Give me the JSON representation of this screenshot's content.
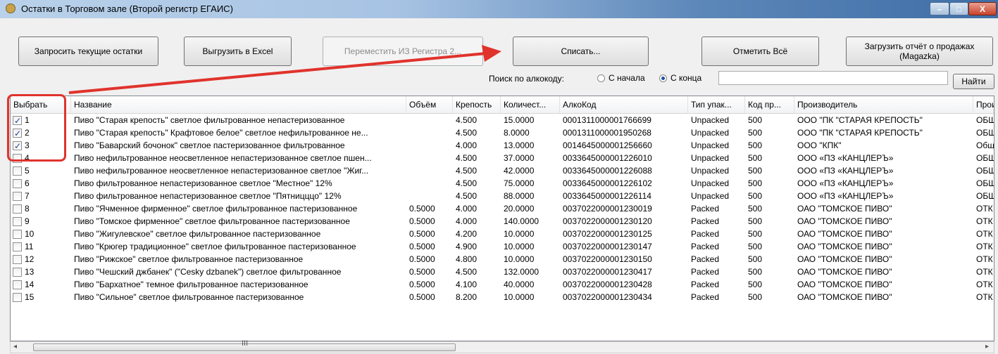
{
  "window": {
    "title": "Остатки в Торговом зале (Второй регистр ЕГАИС)",
    "close": "X",
    "min": "–",
    "max": "□"
  },
  "toolbar": {
    "request_stock": "Запросить текущие остатки",
    "export_excel": "Выгрузить в Excel",
    "move_from_register": "Переместить ИЗ Регистра 2...",
    "write_off": "Списать...",
    "select_all": "Отметить Всё",
    "load_sales": "Загрузить отчёт о продажах (Magazka)"
  },
  "search": {
    "label": "Поиск по алкокоду:",
    "from_start": "С начала",
    "from_end": "С конца",
    "selected": "С конца",
    "value": "",
    "find": "Найти"
  },
  "table": {
    "columns": [
      "Выбрать",
      "Название",
      "Объём",
      "Крепость",
      "Количест...",
      "АлкоКод",
      "Тип упак...",
      "Код пр...",
      "Производитель",
      "Прои"
    ],
    "rows": [
      {
        "checked": true,
        "num": "1",
        "name": "Пиво \"Старая крепость\" светлое фильтрованное непастеризованное",
        "volume": "",
        "abv": "4.500",
        "qty": "15.0000",
        "code": "0001311000001766699",
        "pack": "Unpacked",
        "prodcode": "500",
        "maker": "ООО \"ПК \"СТАРАЯ КРЕПОСТЬ\"",
        "extra": "ОБЩ"
      },
      {
        "checked": true,
        "num": "2",
        "name": "Пиво \"Старая крепость\" Крафтовое белое\" светлое нефильтрованное не...",
        "volume": "",
        "abv": "4.500",
        "qty": "8.0000",
        "code": "0001311000001950268",
        "pack": "Unpacked",
        "prodcode": "500",
        "maker": "ООО \"ПК \"СТАРАЯ КРЕПОСТЬ\"",
        "extra": "ОБЩ"
      },
      {
        "checked": true,
        "num": "3",
        "name": "Пиво \"Баварский бочонок\" светлое пастеризованное фильтрованное",
        "volume": "",
        "abv": "4.000",
        "qty": "13.0000",
        "code": "0014645000001256660",
        "pack": "Unpacked",
        "prodcode": "500",
        "maker": "ООО \"КПК\"",
        "extra": "Общ"
      },
      {
        "checked": false,
        "num": "4",
        "name": "Пиво нефильтрованное неосветленное непастеризованное светлое пшен...",
        "volume": "",
        "abv": "4.500",
        "qty": "37.0000",
        "code": "0033645000001226010",
        "pack": "Unpacked",
        "prodcode": "500",
        "maker": "ООО «ПЗ «КАНЦЛЕРЪ»",
        "extra": "ОБЩ"
      },
      {
        "checked": false,
        "num": "5",
        "name": "Пиво нефильтрованное неосветленное непастеризованное светлое \"Жиг...",
        "volume": "",
        "abv": "4.500",
        "qty": "42.0000",
        "code": "0033645000001226088",
        "pack": "Unpacked",
        "prodcode": "500",
        "maker": "ООО «ПЗ «КАНЦЛЕРЪ»",
        "extra": "ОБЩ"
      },
      {
        "checked": false,
        "num": "6",
        "name": "Пиво фильтрованное непастеризованное светлое \"Местное\" 12%",
        "volume": "",
        "abv": "4.500",
        "qty": "75.0000",
        "code": "0033645000001226102",
        "pack": "Unpacked",
        "prodcode": "500",
        "maker": "ООО «ПЗ «КАНЦЛЕРЪ»",
        "extra": "ОБЩ"
      },
      {
        "checked": false,
        "num": "7",
        "name": "Пиво фильтрованное непастеризованное светлое \"Пятницццо\" 12%",
        "volume": "",
        "abv": "4.500",
        "qty": "88.0000",
        "code": "0033645000001226114",
        "pack": "Unpacked",
        "prodcode": "500",
        "maker": "ООО «ПЗ «КАНЦЛЕРЪ»",
        "extra": "ОБЩ"
      },
      {
        "checked": false,
        "num": "8",
        "name": "Пиво \"Ячменное фирменное\" светлое фильтрованное пастеризованное",
        "volume": "0.5000",
        "abv": "4.000",
        "qty": "20.0000",
        "code": "0037022000001230019",
        "pack": "Packed",
        "prodcode": "500",
        "maker": "ОАО \"ТОМСКОЕ ПИВО\"",
        "extra": "ОТК"
      },
      {
        "checked": false,
        "num": "9",
        "name": "Пиво \"Томское фирменное\" светлое фильтрованное пастеризованное",
        "volume": "0.5000",
        "abv": "4.000",
        "qty": "140.0000",
        "code": "0037022000001230120",
        "pack": "Packed",
        "prodcode": "500",
        "maker": "ОАО \"ТОМСКОЕ ПИВО\"",
        "extra": "ОТК"
      },
      {
        "checked": false,
        "num": "10",
        "name": "Пиво \"Жигулевское\" светлое фильтрованное пастеризованное",
        "volume": "0.5000",
        "abv": "4.200",
        "qty": "10.0000",
        "code": "0037022000001230125",
        "pack": "Packed",
        "prodcode": "500",
        "maker": "ОАО \"ТОМСКОЕ ПИВО\"",
        "extra": "ОТК"
      },
      {
        "checked": false,
        "num": "11",
        "name": "Пиво \"Крюгер традиционное\" светлое фильтрованное пастеризованное",
        "volume": "0.5000",
        "abv": "4.900",
        "qty": "10.0000",
        "code": "0037022000001230147",
        "pack": "Packed",
        "prodcode": "500",
        "maker": "ОАО \"ТОМСКОЕ ПИВО\"",
        "extra": "ОТК"
      },
      {
        "checked": false,
        "num": "12",
        "name": "Пиво \"Рижское\" светлое фильтрованное пастеризованное",
        "volume": "0.5000",
        "abv": "4.800",
        "qty": "10.0000",
        "code": "0037022000001230150",
        "pack": "Packed",
        "prodcode": "500",
        "maker": "ОАО \"ТОМСКОЕ ПИВО\"",
        "extra": "ОТК"
      },
      {
        "checked": false,
        "num": "13",
        "name": "Пиво \"Чешский джбанек\" (\"Cesky dzbanek\") светлое фильтрованное",
        "volume": "0.5000",
        "abv": "4.500",
        "qty": "132.0000",
        "code": "0037022000001230417",
        "pack": "Packed",
        "prodcode": "500",
        "maker": "ОАО \"ТОМСКОЕ ПИВО\"",
        "extra": "ОТК"
      },
      {
        "checked": false,
        "num": "14",
        "name": "Пиво \"Бархатное\" темное фильтрованное пастеризованное",
        "volume": "0.5000",
        "abv": "4.100",
        "qty": "40.0000",
        "code": "0037022000001230428",
        "pack": "Packed",
        "prodcode": "500",
        "maker": "ОАО \"ТОМСКОЕ ПИВО\"",
        "extra": "ОТК"
      },
      {
        "checked": false,
        "num": "15",
        "name": "Пиво \"Сильное\" светлое фильтрованное пастеризованное",
        "volume": "0.5000",
        "abv": "8.200",
        "qty": "10.0000",
        "code": "0037022000001230434",
        "pack": "Packed",
        "prodcode": "500",
        "maker": "ОАО \"ТОМСКОЕ ПИВО\"",
        "extra": "ОТК"
      }
    ]
  },
  "scrollbar": {
    "left": "◂",
    "right": "▸",
    "grip": "III"
  },
  "annotation": {
    "color": "#e0332c"
  }
}
